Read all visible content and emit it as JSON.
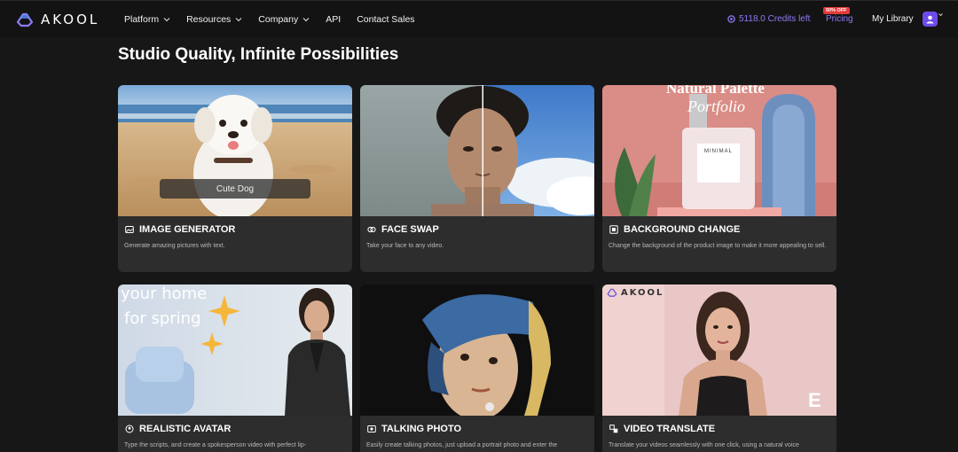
{
  "brand": {
    "name": "AKOOL"
  },
  "nav": {
    "links": [
      {
        "label": "Platform",
        "dropdown": true
      },
      {
        "label": "Resources",
        "dropdown": true
      },
      {
        "label": "Company",
        "dropdown": true
      },
      {
        "label": "API",
        "dropdown": false
      },
      {
        "label": "Contact Sales",
        "dropdown": false
      }
    ],
    "credits": "5118.0 Credits left",
    "pricing": "Pricing",
    "pricing_badge": "50% OFF",
    "library": "My Library"
  },
  "heading": "Studio Quality, Infinite Possibilities",
  "cards": [
    {
      "title": "IMAGE GENERATOR",
      "description": "Generate amazing pictures with text.",
      "icon": "image-icon",
      "overlay": "Cute Dog"
    },
    {
      "title": "FACE SWAP",
      "description": "Take your face to any video.",
      "icon": "face-swap-icon"
    },
    {
      "title": "BACKGROUND CHANGE",
      "description": "Change the background of the product image to make it more appealing to sell.",
      "icon": "background-icon",
      "overlay_title": "Natural Palette",
      "overlay_sub": "Portfolio",
      "bottle_label": "MINIMAL"
    },
    {
      "title": "REALISTIC AVATAR",
      "description": "Type the scripts, and create a spokesperson video with perfect lip-",
      "icon": "avatar-icon",
      "overlay_line1": "your home",
      "overlay_line2": "for spring"
    },
    {
      "title": "TALKING PHOTO",
      "description": "Easily create talking photos, just upload a portrait photo and enter the",
      "icon": "photo-icon"
    },
    {
      "title": "VIDEO TRANSLATE",
      "description": "Translate your videos seamlessly with one click,  using a natural voice",
      "icon": "translate-icon",
      "watermark": "AKOOL",
      "corner_mark": "E"
    }
  ],
  "colors": {
    "accent": "#8b7cf6",
    "badge": "#e5393a",
    "background": "#171717",
    "card": "#2d2d2d"
  }
}
